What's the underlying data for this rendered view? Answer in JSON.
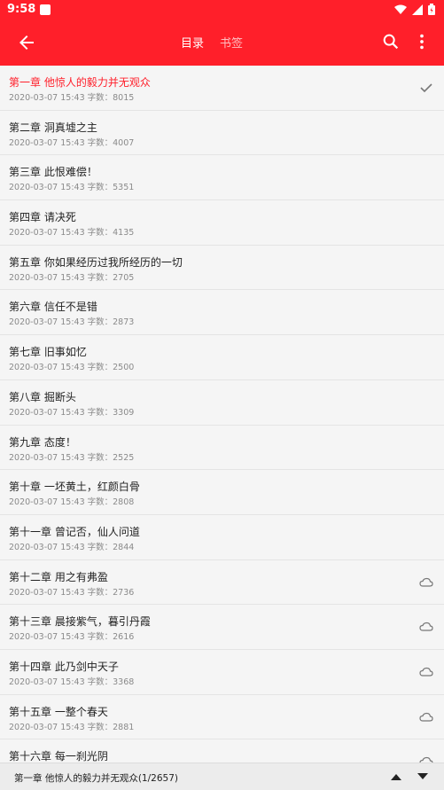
{
  "status_bar": {
    "time": "9:58"
  },
  "toolbar": {
    "tabs": [
      {
        "label": "目录",
        "active": true
      },
      {
        "label": "书签",
        "active": false
      }
    ]
  },
  "chapters": [
    {
      "title": "第一章 他惊人的毅力并无观众",
      "meta": "2020-03-07 15:43 字数：8015",
      "status": "current"
    },
    {
      "title": "第二章 洞真墟之主",
      "meta": "2020-03-07 15:43 字数：4007",
      "status": "downloaded"
    },
    {
      "title": "第三章 此恨难偿！",
      "meta": "2020-03-07 15:43 字数：5351",
      "status": "downloaded"
    },
    {
      "title": "第四章 请决死",
      "meta": "2020-03-07 15:43 字数：4135",
      "status": "downloaded"
    },
    {
      "title": "第五章 你如果经历过我所经历的一切",
      "meta": "2020-03-07 15:43 字数：2705",
      "status": "downloaded"
    },
    {
      "title": "第六章 信任不是错",
      "meta": "2020-03-07 15:43 字数：2873",
      "status": "downloaded"
    },
    {
      "title": "第七章 旧事如忆",
      "meta": "2020-03-07 15:43 字数：2500",
      "status": "downloaded"
    },
    {
      "title": "第八章 掘断头",
      "meta": "2020-03-07 15:43 字数：3309",
      "status": "downloaded"
    },
    {
      "title": "第九章 态度！",
      "meta": "2020-03-07 15:43 字数：2525",
      "status": "downloaded"
    },
    {
      "title": "第十章 一坯黄土，红颜白骨",
      "meta": "2020-03-07 15:43 字数：2808",
      "status": "downloaded"
    },
    {
      "title": "第十一章 曾记否，仙人问道",
      "meta": "2020-03-07 15:43 字数：2844",
      "status": "downloaded"
    },
    {
      "title": "第十二章 用之有弗盈",
      "meta": "2020-03-07 15:43 字数：2736",
      "status": "cloud"
    },
    {
      "title": "第十三章 晨接紫气，暮引丹霞",
      "meta": "2020-03-07 15:43 字数：2616",
      "status": "cloud"
    },
    {
      "title": "第十四章 此乃剑中天子",
      "meta": "2020-03-07 15:43 字数：3368",
      "status": "cloud"
    },
    {
      "title": "第十五章 一整个春天",
      "meta": "2020-03-07 15:43 字数：2881",
      "status": "cloud"
    },
    {
      "title": "第十六章 每一刹光阴",
      "meta": "",
      "status": "cloud"
    }
  ],
  "bottom_bar": {
    "label": "第一章 他惊人的毅力并无观众(1/2657)"
  },
  "colors": {
    "accent": "#ff1f2a",
    "background": "#f5f5f5"
  }
}
